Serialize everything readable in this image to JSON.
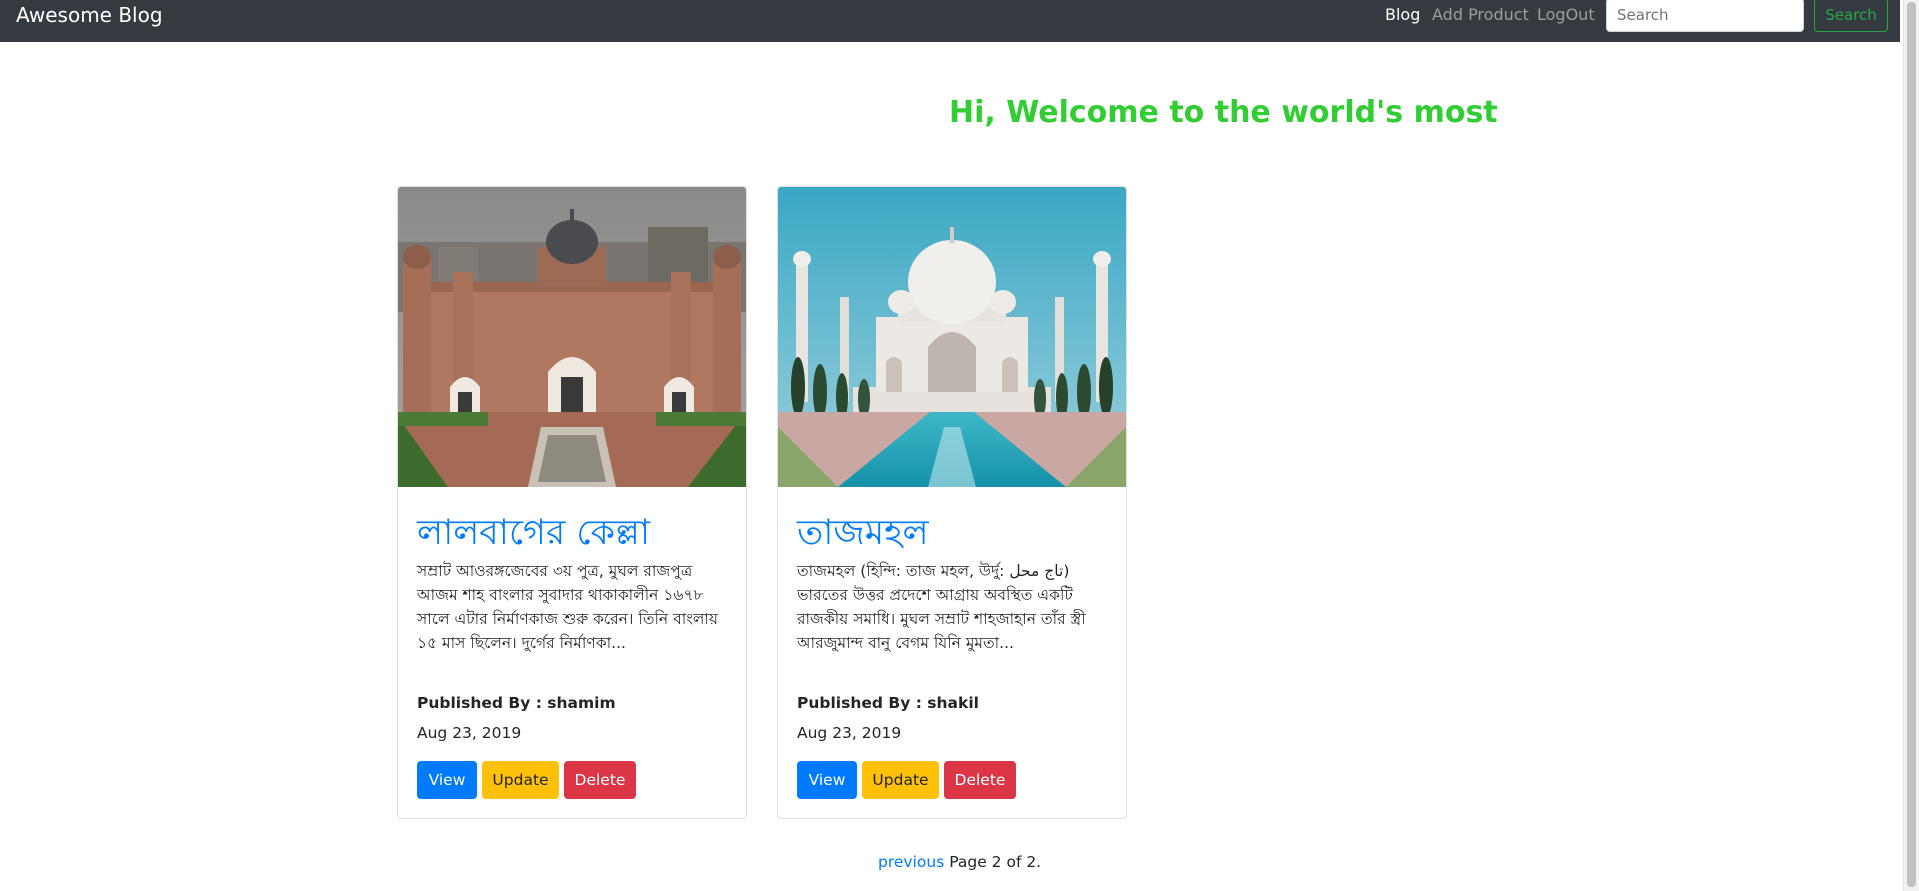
{
  "navbar": {
    "brand": "Awesome Blog",
    "links": [
      "Blog",
      "Add Product",
      "LogOut"
    ],
    "search_placeholder": "Search",
    "search_button": "Search"
  },
  "marquee": {
    "text": "Hi, Welcome to the world's most beautiful places",
    "color": "#32cd32"
  },
  "cards": [
    {
      "image": "lalbagh-fort-image",
      "title": "লালবাগের কেল্লা",
      "excerpt": "সম্রাট আওরঙ্গজেবের ৩য় পুত্র, মুঘল রাজপুত্র আজম শাহ বাংলার সুবাদার থাকাকালীন ১৬৭৮ সালে এটার নির্মাণকাজ শুরু করেন। তিনি বাংলায় ১৫ মাস ছিলেন। দুর্গের নির্মাণকা...",
      "author": "Published By : shamim",
      "date": "Aug 23, 2019",
      "buttons": {
        "view": "View",
        "update": "Update",
        "delete": "Delete"
      }
    },
    {
      "image": "taj-mahal-image",
      "title": "তাজমহল",
      "excerpt": "তাজমহল (হিন্দি: তাজ মহল, উর্দু: تاج محل) ভারতের উত্তর প্রদেশে আগ্রায় অবস্থিত একটি রাজকীয় সমাধি। মুঘল সম্রাট শাহজাহান তাঁর স্ত্রী আরজুমান্দ বানু বেগম যিনি মুমতা...",
      "author": "Published By : shakil",
      "date": "Aug 23, 2019",
      "buttons": {
        "view": "View",
        "update": "Update",
        "delete": "Delete"
      }
    }
  ],
  "pagination": {
    "previous": "previous",
    "info": "Page 2 of 2."
  },
  "colors": {
    "navbar_bg": "#343a40",
    "link_blue": "#007bff",
    "warning": "#ffc107",
    "danger": "#dc3545",
    "success": "#28a745"
  }
}
